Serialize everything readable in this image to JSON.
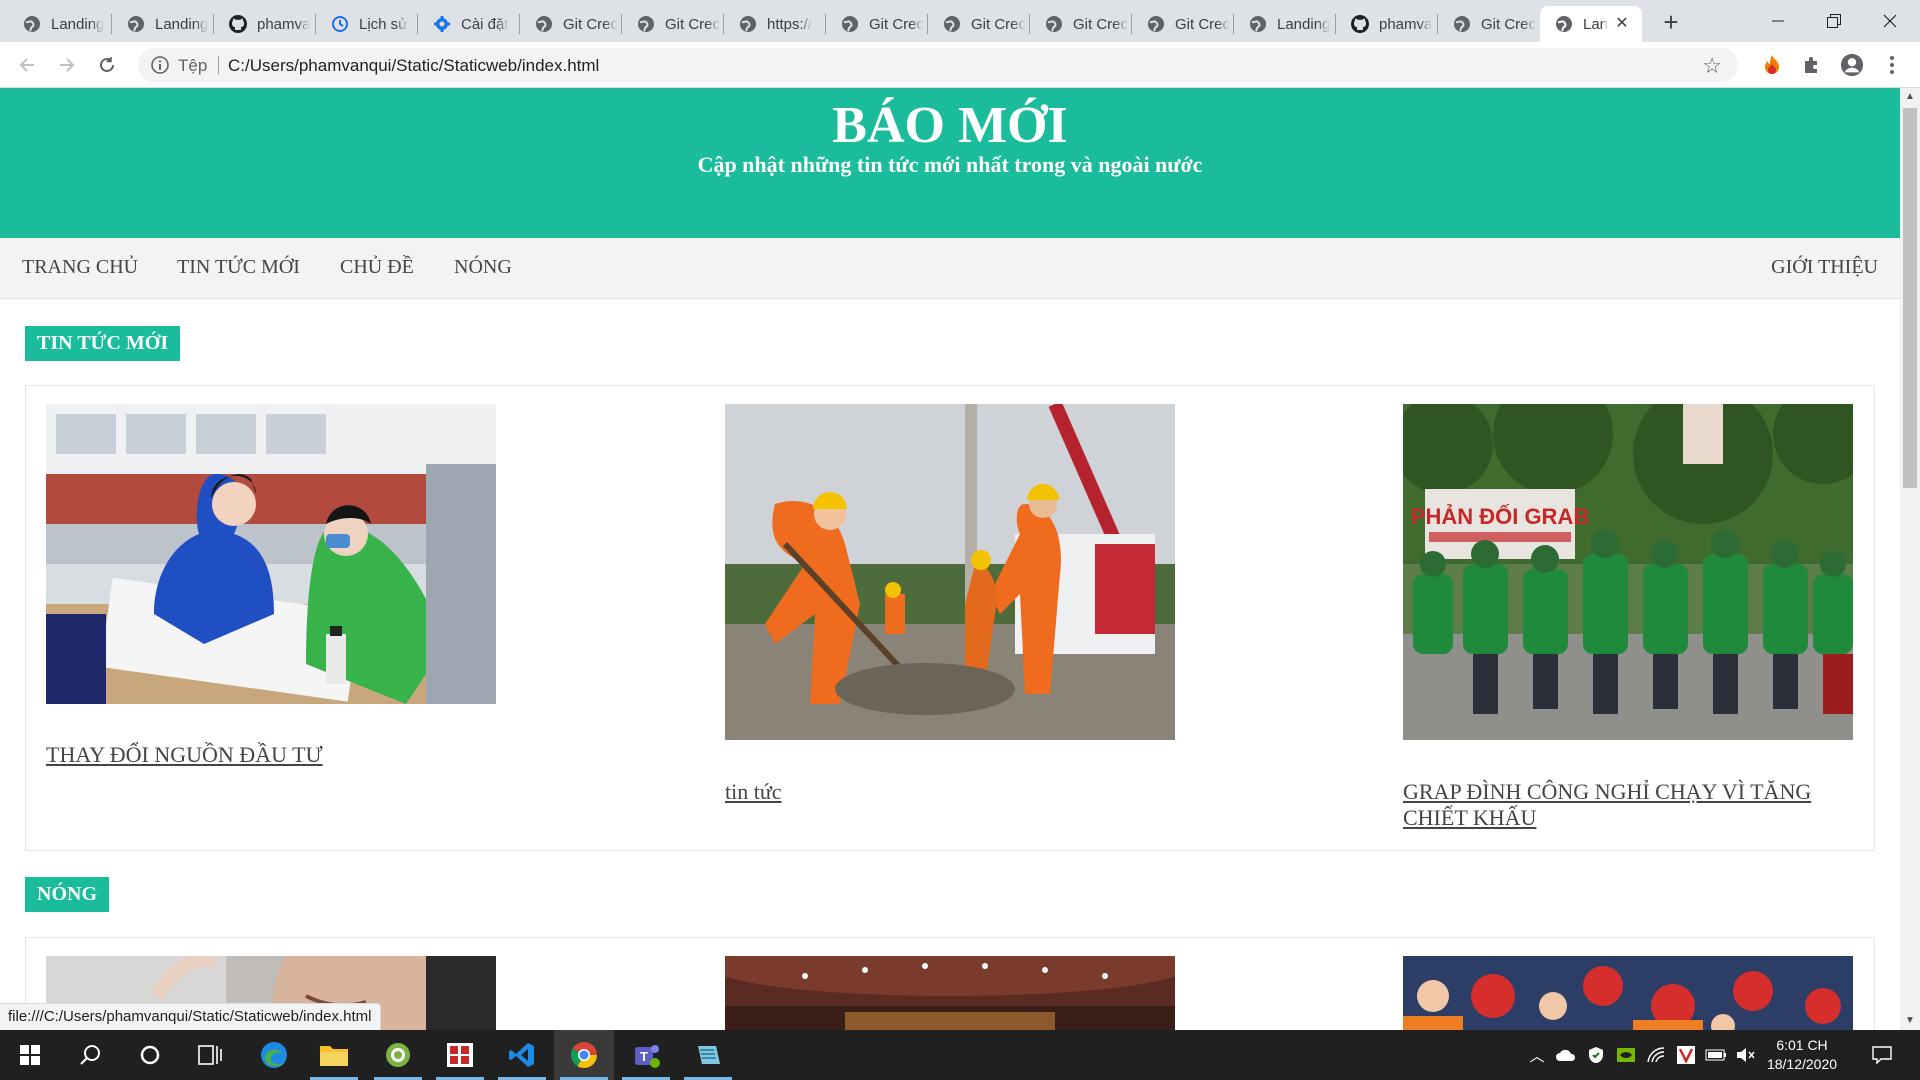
{
  "browser": {
    "tabs": [
      {
        "title": "Landing",
        "icon": "globe-icon"
      },
      {
        "title": "Landing",
        "icon": "globe-icon"
      },
      {
        "title": "phamva",
        "icon": "github-icon"
      },
      {
        "title": "Lịch sử",
        "icon": "history-icon"
      },
      {
        "title": "Cài đặt",
        "icon": "gear-icon"
      },
      {
        "title": "Git Crec",
        "icon": "globe-icon"
      },
      {
        "title": "Git Crec",
        "icon": "globe-icon"
      },
      {
        "title": "https://",
        "icon": "globe-icon"
      },
      {
        "title": "Git Crec",
        "icon": "globe-icon"
      },
      {
        "title": "Git Crec",
        "icon": "globe-icon"
      },
      {
        "title": "Git Crec",
        "icon": "globe-icon"
      },
      {
        "title": "Git Crec",
        "icon": "globe-icon"
      },
      {
        "title": "Landing",
        "icon": "globe-icon"
      },
      {
        "title": "phamva",
        "icon": "github-icon"
      },
      {
        "title": "Git Crec",
        "icon": "globe-icon"
      },
      {
        "title": "Lan",
        "icon": "globe-icon",
        "active": true
      }
    ],
    "address": {
      "scheme_label": "Tệp",
      "url": "C:/Users/phamvanqui/Static/Staticweb/index.html"
    },
    "status_url": "file:///C:/Users/phamvanqui/Static/Staticweb/index.html"
  },
  "site": {
    "title": "BÁO MỚI",
    "subtitle": "Cập nhật những tin tức mới nhất trong và ngoài nước",
    "nav": [
      "TRANG CHỦ",
      "TIN TỨC MỚI",
      "CHỦ ĐỀ",
      "NÓNG"
    ],
    "nav_right": "GIỚI THIỆU",
    "sections": [
      {
        "label": "TIN TỨC MỚI",
        "items": [
          {
            "title": "THAY ĐỔI NGUỒN ĐẦU TƯ",
            "image": "bank-counter-photo"
          },
          {
            "title": "tin tức",
            "image": "electric-workers-photo"
          },
          {
            "title": "GRAP ĐÌNH CÔNG NGHỈ CHẠY VÌ TĂNG CHIẾT KHẤU",
            "image": "grab-protest-photo"
          }
        ],
        "banner_text": "PHẢN ĐỐI GRAB"
      },
      {
        "label": "NÓNG",
        "items": [
          {
            "image": "man-portrait-photo"
          },
          {
            "image": "conference-hall-photo"
          },
          {
            "image": "rescue-crowd-photo"
          }
        ]
      }
    ]
  },
  "taskbar": {
    "time": "6:01 CH",
    "date": "18/12/2020"
  },
  "colors": {
    "accent": "#1abc9c",
    "nav_bg": "#f3f3f3",
    "taskbar": "#202020"
  }
}
